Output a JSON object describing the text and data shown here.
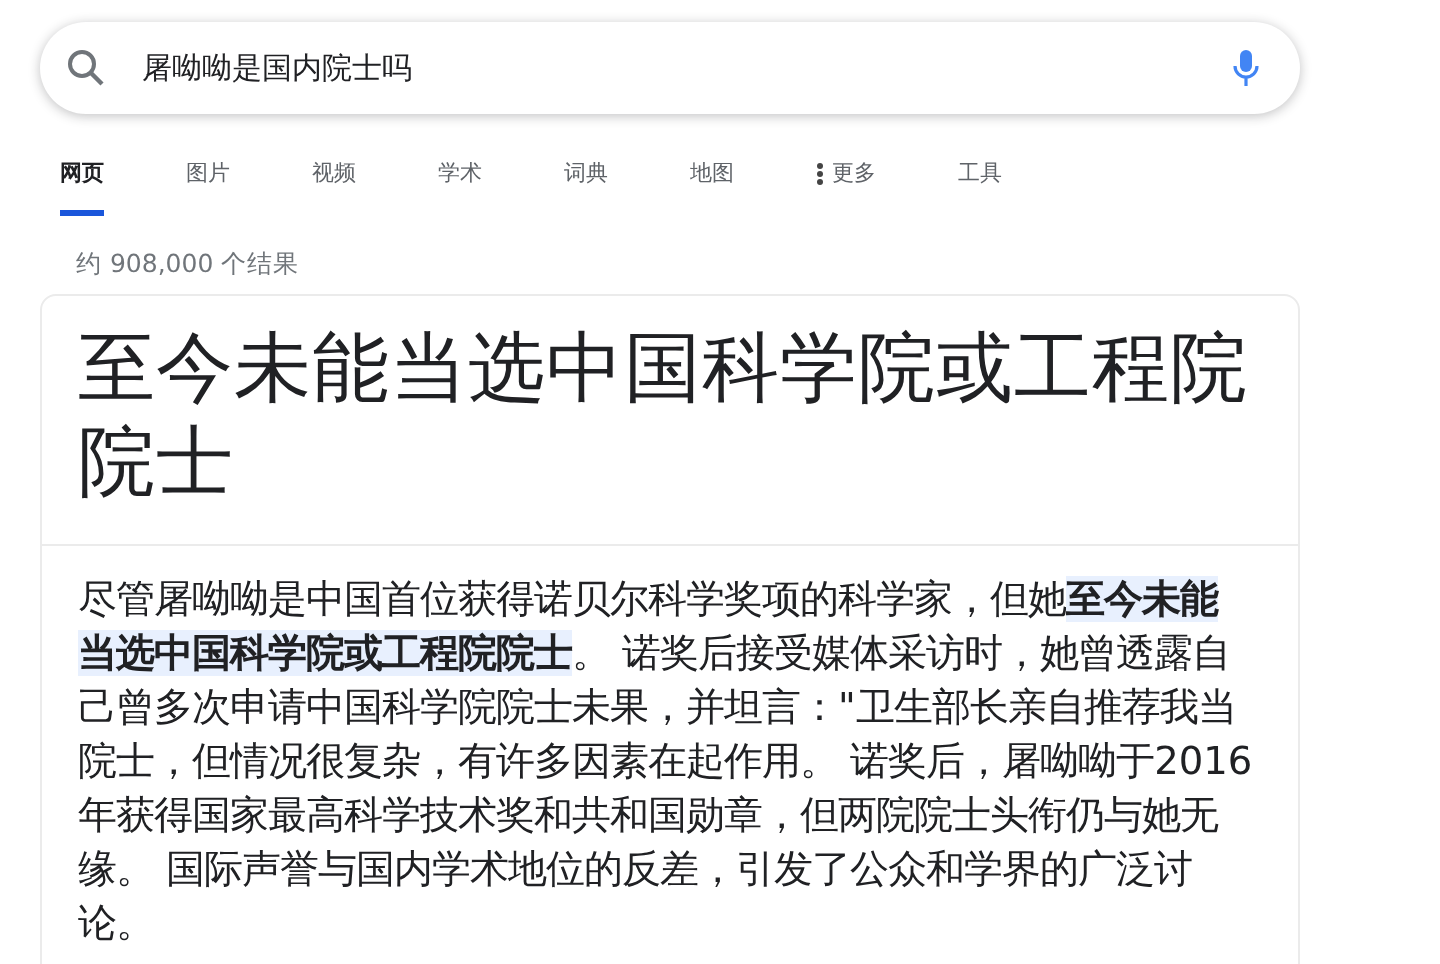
{
  "search": {
    "value": "屠呦呦是国内院士吗"
  },
  "tabs": [
    {
      "label": "网页",
      "selected": true
    },
    {
      "label": "图片",
      "selected": false
    },
    {
      "label": "视频",
      "selected": false
    },
    {
      "label": "学术",
      "selected": false
    },
    {
      "label": "词典",
      "selected": false
    },
    {
      "label": "地图",
      "selected": false
    },
    {
      "label": "更多",
      "selected": false,
      "kind": "more"
    },
    {
      "label": "工具",
      "selected": false
    }
  ],
  "result_count": "约 908,000 个结果",
  "snippet": {
    "title": "至今未能当选中国科学院或工程院院士",
    "text": "尽管屠呦呦是中国首位获得诺贝尔科学奖项的科学家，但她**至今未能当选中国科学院或工程院院士**。 诺奖后接受媒体采访时，她曾透露自己曾多次申请中国科学院院士未果，并坦言：\"卫生部长亲自推荐我当院士，但情况很复杂，有许多因素在起作用。 诺奖后，屠呦呦于2016年获得国家最高科学技术奖和共和国勋章，但两院院士头衔仍与她无缘。 国际声誉与国内学术地位的反差，引发了公众和学界的广泛讨论。"
  }
}
